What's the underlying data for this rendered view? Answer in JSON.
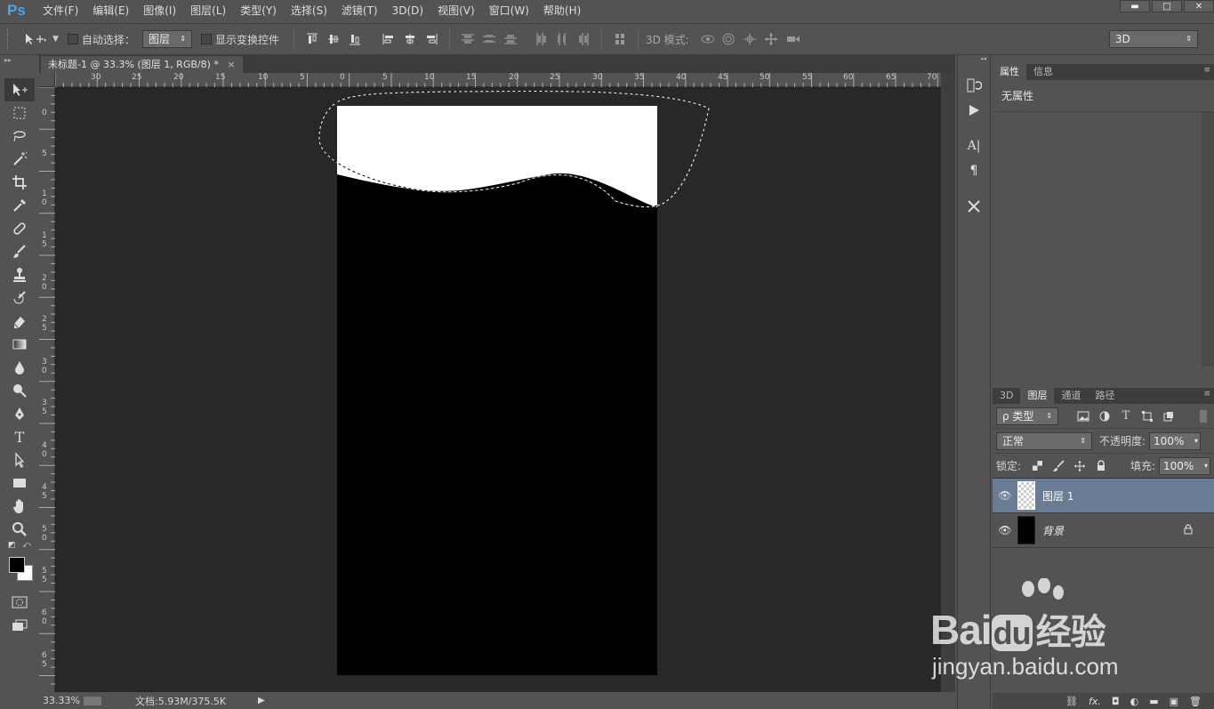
{
  "app": {
    "logo": "Ps"
  },
  "menu": [
    "文件(F)",
    "编辑(E)",
    "图像(I)",
    "图层(L)",
    "类型(Y)",
    "选择(S)",
    "滤镜(T)",
    "3D(D)",
    "视图(V)",
    "窗口(W)",
    "帮助(H)"
  ],
  "window_controls": {
    "minimize": "▬",
    "maximize": "□",
    "close": "✕"
  },
  "options": {
    "auto_select_label": "自动选择：",
    "auto_select_value": "图层",
    "show_transform_label": "显示变换控件",
    "mode3d_label": "3D 模式:",
    "workspace": "3D"
  },
  "document": {
    "tab_title": "未标题-1 @ 33.3% (图层 1, RGB/8) *",
    "close": "×"
  },
  "ruler_h": [
    "30",
    "25",
    "20",
    "15",
    "10",
    "5",
    "0",
    "5",
    "10",
    "15",
    "20",
    "25",
    "30",
    "35",
    "40",
    "45",
    "50",
    "55",
    "60",
    "65",
    "70"
  ],
  "ruler_v": [
    "0",
    "5",
    "1 0",
    "1 5",
    "2 0",
    "2 5",
    "3 0",
    "3 5",
    "4 0",
    "4 5",
    "5 0",
    "5 5",
    "6 0",
    "6 5"
  ],
  "status": {
    "zoom": "33.33%",
    "doc_info": "文档:5.93M/375.5K"
  },
  "properties_panel": {
    "tabs": [
      "属性",
      "信息"
    ],
    "content": "无属性"
  },
  "layers_panel": {
    "tabs": [
      "3D",
      "图层",
      "通道",
      "路径"
    ],
    "filter_label": "ρ 类型",
    "blend_mode": "正常",
    "opacity_label": "不透明度:",
    "opacity": "100%",
    "lock_label": "锁定:",
    "fill_label": "填充:",
    "fill": "100%",
    "layers": [
      {
        "name": "图层 1",
        "selected": true
      },
      {
        "name": "背景",
        "locked": true
      }
    ]
  },
  "watermark": {
    "brand": "Bai",
    "brand2": "du",
    "brand_cn": "经验",
    "url": "jingyan.baidu.com"
  },
  "colors": {
    "ui": "#535353",
    "canvas_bg": "#282828",
    "selected_layer": "#697c94",
    "ps_blue": "#4fa3e6"
  }
}
